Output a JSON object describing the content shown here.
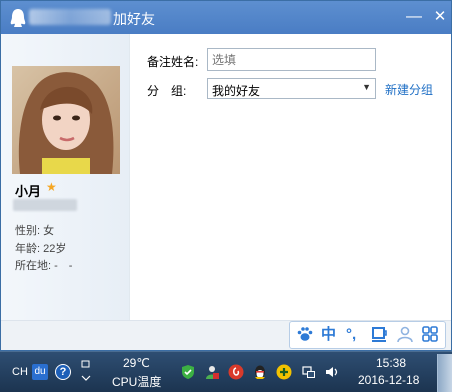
{
  "window": {
    "title": "加好友",
    "minimize_glyph": "—",
    "close_glyph": "✕"
  },
  "profile": {
    "nickname": "小月",
    "star_glyph": "★",
    "gender": "性别: 女",
    "age": "年龄: 22岁",
    "location": "所在地: -　-"
  },
  "form": {
    "remark_label": "备注姓名:",
    "remark_placeholder": "选填",
    "group_label": "分　组:",
    "group_value": "我的好友",
    "new_group_link": "新建分组"
  },
  "ime_toolbar": {
    "items": [
      "paw-icon",
      "中",
      "°,",
      "cup-icon",
      "person-icon",
      "grid-icon"
    ],
    "mode_label": "中",
    "punct_label": "°,"
  },
  "taskbar": {
    "lang": "CH",
    "baidu_label": "du",
    "help_glyph": "?",
    "temperature": "29℃",
    "cpu_label": "CPU温度",
    "time": "15:38",
    "date": "2016-12-18"
  },
  "colors": {
    "titlebar": "#4a7dc4",
    "link": "#1f6fc5",
    "taskbar": "#1c3450",
    "ime_accent": "#2d7ad6"
  }
}
